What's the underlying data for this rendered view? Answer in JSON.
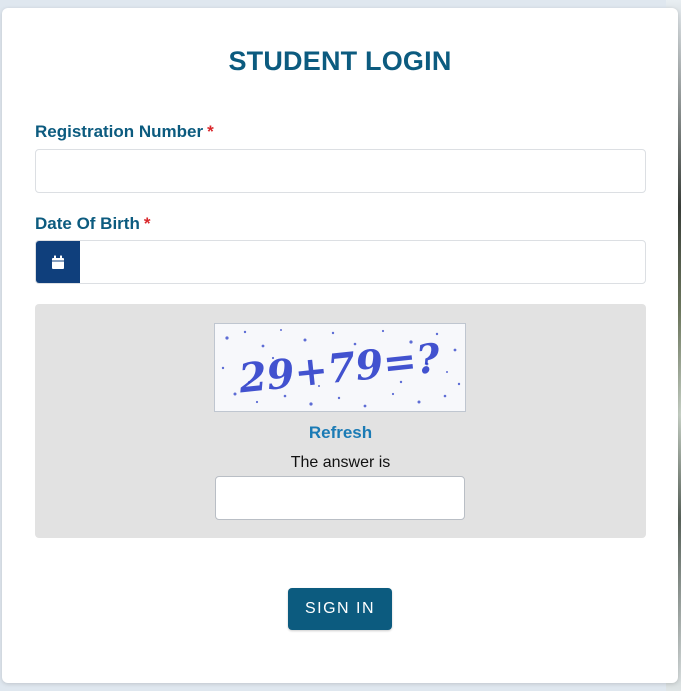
{
  "form": {
    "title": "STUDENT LOGIN",
    "registration": {
      "label": "Registration Number",
      "required_mark": "*",
      "value": "",
      "placeholder": ""
    },
    "dob": {
      "label": "Date Of Birth",
      "required_mark": "*",
      "value": "",
      "placeholder": "",
      "icon": "calendar-icon"
    },
    "captcha": {
      "image_text": "29+79=?",
      "refresh_label": "Refresh",
      "answer_label": "The answer is",
      "answer_value": ""
    },
    "submit_label": "SIGN IN"
  },
  "colors": {
    "primary": "#0c5b7f",
    "required": "#d9262a",
    "link": "#1b7bb5",
    "calendar_button": "#0f3f7c",
    "captcha_panel": "#e2e2e2"
  }
}
